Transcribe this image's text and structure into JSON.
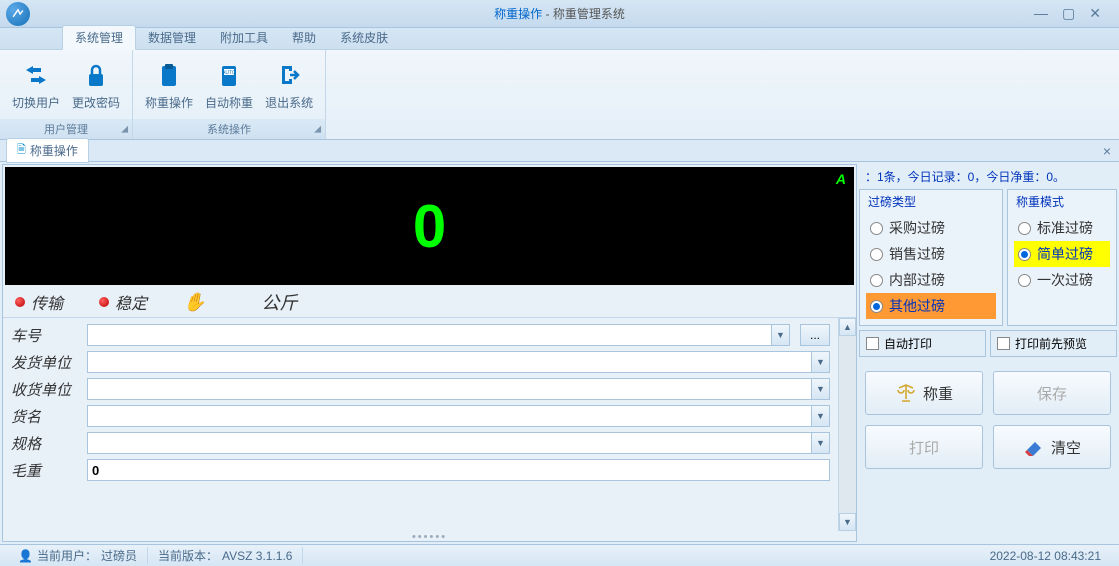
{
  "title": {
    "page": "称重操作",
    "app": "称重管理系统"
  },
  "menu": {
    "tabs": [
      "系统管理",
      "数据管理",
      "附加工具",
      "帮助",
      "系统皮肤"
    ],
    "active": 0
  },
  "ribbon": {
    "groups": [
      {
        "label": "用户管理",
        "items": [
          {
            "label": "切换用户"
          },
          {
            "label": "更改密码"
          }
        ]
      },
      {
        "label": "系统操作",
        "items": [
          {
            "label": "称重操作"
          },
          {
            "label": "自动称重"
          },
          {
            "label": "退出系统"
          }
        ]
      }
    ]
  },
  "doc_tab": {
    "label": "称重操作"
  },
  "display": {
    "value": "0",
    "letter": "A"
  },
  "status": {
    "transfer": "传输",
    "stable": "稳定",
    "unit": "公斤"
  },
  "form": {
    "fields": [
      {
        "label": "车号",
        "value": "",
        "type": "combo",
        "dots": true
      },
      {
        "label": "发货单位",
        "value": "",
        "type": "combo"
      },
      {
        "label": "收货单位",
        "value": "",
        "type": "combo"
      },
      {
        "label": "货名",
        "value": "",
        "type": "combo"
      },
      {
        "label": "规格",
        "value": "",
        "type": "combo"
      },
      {
        "label": "毛重",
        "value": "0",
        "type": "text"
      }
    ]
  },
  "summary": "：1条，今日记录：0，今日净重：0。",
  "type_box": {
    "title": "过磅类型",
    "options": [
      "采购过磅",
      "销售过磅",
      "内部过磅",
      "其他过磅"
    ],
    "selected": 3
  },
  "mode_box": {
    "title": "称重模式",
    "options": [
      "标准过磅",
      "简单过磅",
      "一次过磅"
    ],
    "selected": 1
  },
  "checks": {
    "auto_print": "自动打印",
    "preview": "打印前先预览"
  },
  "actions": {
    "weigh": "称重",
    "save": "保存",
    "print": "打印",
    "clear": "清空"
  },
  "statusbar": {
    "user_label": "当前用户：",
    "user": "过磅员",
    "version_label": "当前版本：",
    "version": "AVSZ 3.1.1.6",
    "datetime": "2022-08-12 08:43:21"
  }
}
